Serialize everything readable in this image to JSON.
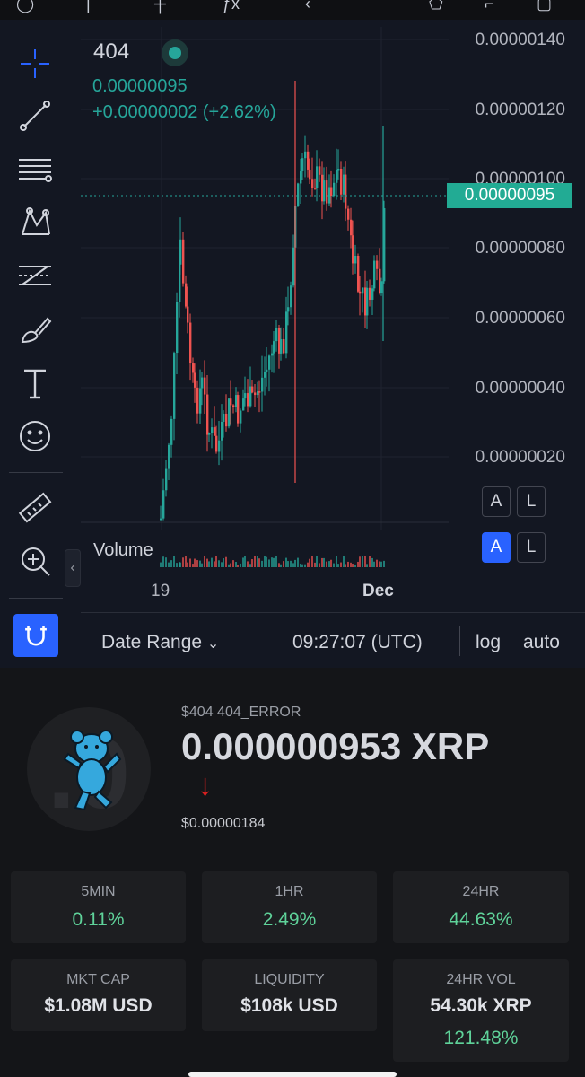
{
  "chart": {
    "symbol": "404",
    "last_price": "0.00000095",
    "change": "+0.00000002 (+2.62%)",
    "price_tag": "0.00000095",
    "y_labels": [
      "0.00000140",
      "0.00000120",
      "0.00000100",
      "0.00000080",
      "0.00000060",
      "0.00000040",
      "0.00000020"
    ],
    "x_labels": [
      "19",
      "Dec"
    ],
    "volume_label": "Volume",
    "scale_buttons": {
      "a": "A",
      "l": "L"
    },
    "bottom": {
      "date_range": "Date Range",
      "time": "09:27:07 (UTC)",
      "log": "log",
      "auto": "auto"
    },
    "up_color": "#26a69a",
    "down_color": "#ef5350"
  },
  "token": {
    "name": "$404 404_ERROR",
    "price_xrp": "0.000000953 XRP",
    "down_arrow": "↓",
    "price_usd": "$0.00000184"
  },
  "stats": [
    {
      "label": "5MIN",
      "value": "0.11%"
    },
    {
      "label": "1HR",
      "value": "2.49%"
    },
    {
      "label": "24HR",
      "value": "44.63%"
    },
    {
      "label": "MKT CAP",
      "value": "$1.08M USD"
    },
    {
      "label": "LIQUIDITY",
      "value": "$108k USD"
    },
    {
      "label": "24HR VOL",
      "value": "54.30k XRP",
      "sub": "121.48%"
    }
  ]
}
